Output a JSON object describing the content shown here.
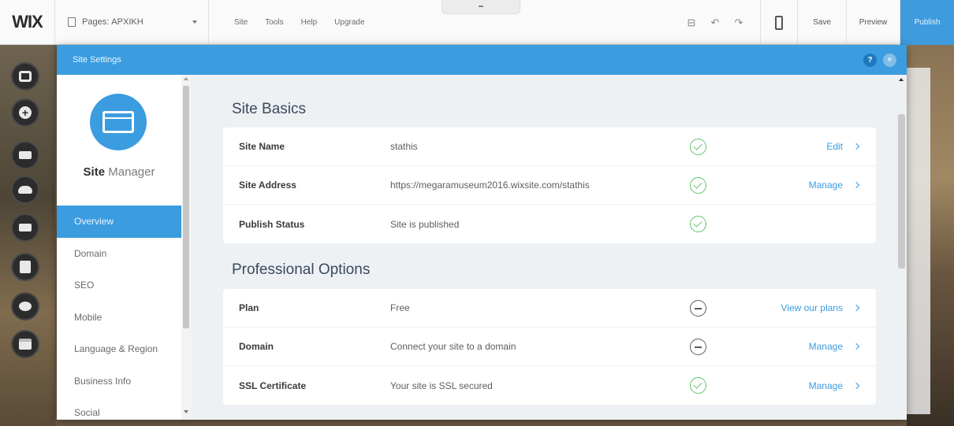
{
  "topbar": {
    "logo": "WIX",
    "pages_label": "Pages: ΑΡΧΙΚΗ",
    "menu": [
      "Site",
      "Tools",
      "Help",
      "Upgrade"
    ],
    "save_label": "Save",
    "preview_label": "Preview",
    "publish_label": "Publish"
  },
  "dialog": {
    "title": "Site Settings",
    "help_label": "?",
    "close_label": "×"
  },
  "sidebar": {
    "title_bold": "Site",
    "title_light": "Manager",
    "items": [
      {
        "label": "Overview",
        "active": true
      },
      {
        "label": "Domain",
        "active": false
      },
      {
        "label": "SEO",
        "active": false
      },
      {
        "label": "Mobile",
        "active": false
      },
      {
        "label": "Language & Region",
        "active": false
      },
      {
        "label": "Business Info",
        "active": false
      },
      {
        "label": "Social",
        "active": false
      }
    ]
  },
  "basics": {
    "title": "Site Basics",
    "rows": [
      {
        "label": "Site Name",
        "value": "stathis",
        "status": "ok",
        "action": "Edit"
      },
      {
        "label": "Site Address",
        "value": "https://megaramuseum2016.wixsite.com/stathis",
        "status": "ok",
        "action": "Manage"
      },
      {
        "label": "Publish Status",
        "value": "Site is published",
        "status": "ok",
        "action": ""
      }
    ]
  },
  "professional": {
    "title": "Professional Options",
    "rows": [
      {
        "label": "Plan",
        "value": "Free",
        "status": "minus",
        "action": "View our plans"
      },
      {
        "label": "Domain",
        "value": "Connect your site to a domain",
        "status": "minus",
        "action": "Manage"
      },
      {
        "label": "SSL Certificate",
        "value": "Your site is SSL secured",
        "status": "ok",
        "action": "Manage"
      }
    ]
  },
  "colors": {
    "accent": "#3b9ce0",
    "success": "#5fc46a"
  }
}
